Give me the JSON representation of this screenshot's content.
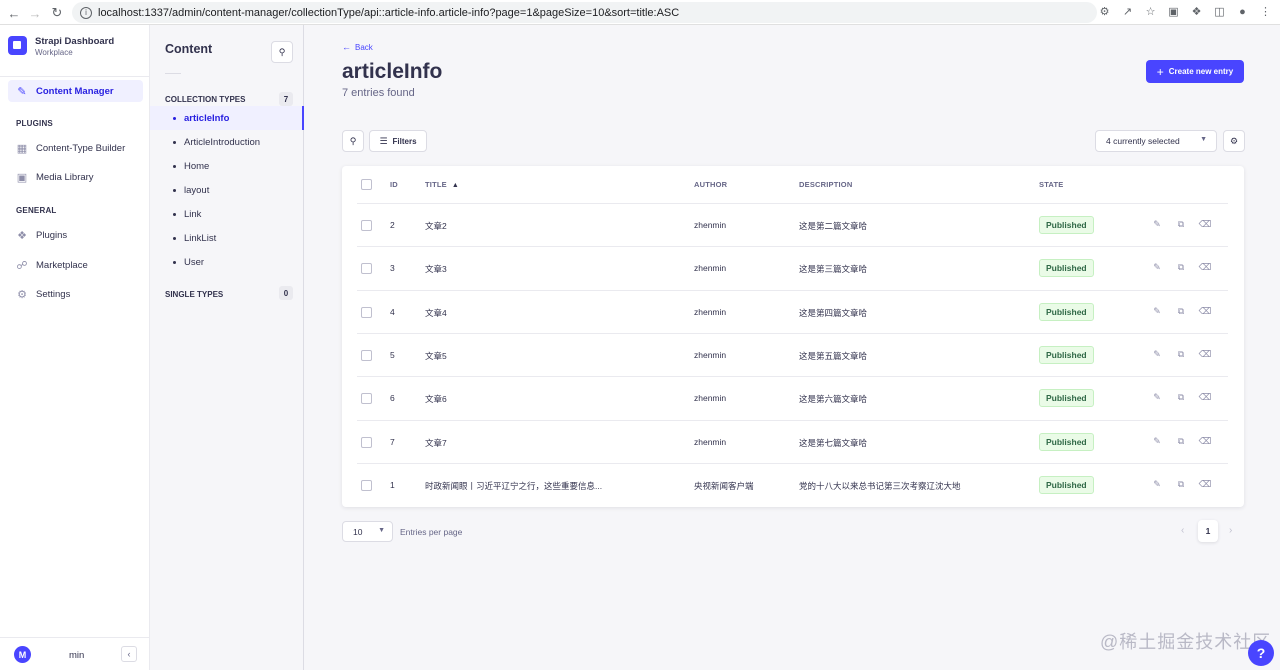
{
  "browser": {
    "url": "localhost:1337/admin/content-manager/collectionType/api::article-info.article-info?page=1&pageSize=10&sort=title:ASC"
  },
  "brand": {
    "title": "Strapi Dashboard",
    "subtitle": "Workplace"
  },
  "mainnav": {
    "active_item": "Content Manager",
    "plugins_label": "PLUGINS",
    "plugins": [
      "Content-Type Builder",
      "Media Library"
    ],
    "general_label": "GENERAL",
    "general": [
      "Plugins",
      "Marketplace",
      "Settings"
    ],
    "user_initial": "M",
    "username": "min"
  },
  "subnav": {
    "title": "Content",
    "collection_label": "COLLECTION TYPES",
    "collection_count": "7",
    "collection_items": [
      "articleInfo",
      "ArticleIntroduction",
      "Home",
      "layout",
      "Link",
      "LinkList",
      "User"
    ],
    "single_label": "SINGLE TYPES",
    "single_count": "0"
  },
  "header": {
    "back": "Back",
    "title": "articleInfo",
    "subtitle": "7 entries found",
    "create_button": "Create new entry"
  },
  "toolbar": {
    "filters": "Filters",
    "columns_selected": "4 currently selected"
  },
  "table": {
    "headers": {
      "id": "ID",
      "title": "TITLE",
      "author": "AUTHOR",
      "description": "DESCRIPTION",
      "state": "STATE"
    },
    "rows": [
      {
        "id": "2",
        "title": "文章2",
        "author": "zhenmin",
        "description": "这是第二篇文章哈",
        "state": "Published"
      },
      {
        "id": "3",
        "title": "文章3",
        "author": "zhenmin",
        "description": "这是第三篇文章哈",
        "state": "Published"
      },
      {
        "id": "4",
        "title": "文章4",
        "author": "zhenmin",
        "description": "这是第四篇文章哈",
        "state": "Published"
      },
      {
        "id": "5",
        "title": "文章5",
        "author": "zhenmin",
        "description": "这是第五篇文章哈",
        "state": "Published"
      },
      {
        "id": "6",
        "title": "文章6",
        "author": "zhenmin",
        "description": "这是第六篇文章哈",
        "state": "Published"
      },
      {
        "id": "7",
        "title": "文章7",
        "author": "zhenmin",
        "description": "这是第七篇文章哈",
        "state": "Published"
      },
      {
        "id": "1",
        "title": "时政新闻眼丨习近平辽宁之行，这些重要信息...",
        "author": "央视新闻客户端",
        "description": "党的十八大以来总书记第三次考察辽沈大地",
        "state": "Published"
      }
    ]
  },
  "footer": {
    "page_size": "10",
    "per_page_label": "Entries per page",
    "current_page": "1"
  },
  "watermark": "@稀土掘金技术社区",
  "help": "?"
}
